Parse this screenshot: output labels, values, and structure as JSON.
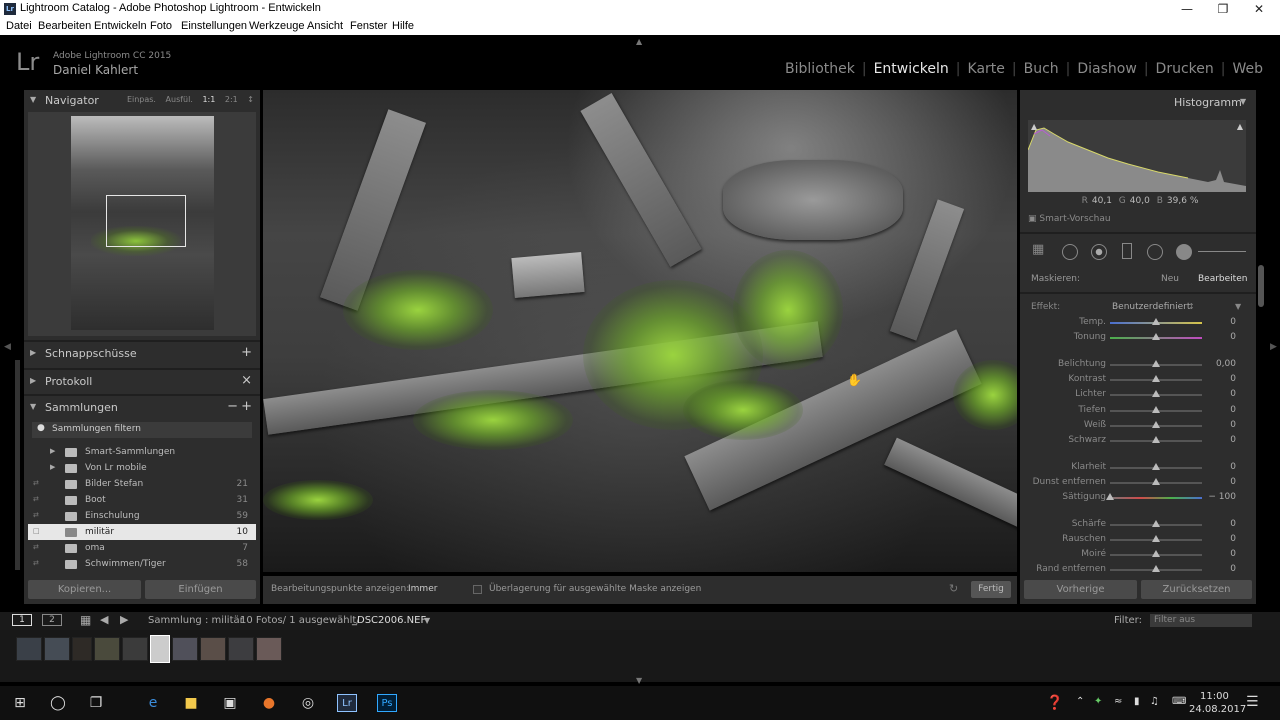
{
  "window": {
    "title": "Lightroom Catalog - Adobe Photoshop Lightroom - Entwickeln",
    "app_icon": "Lr"
  },
  "menu": [
    "Datei",
    "Bearbeiten",
    "Entwickeln",
    "Foto",
    "Einstellungen",
    "Werkzeuge",
    "Ansicht",
    "Fenster",
    "Hilfe"
  ],
  "identity": {
    "logo": "Lr",
    "product": "Adobe Lightroom CC 2015",
    "user": "Daniel Kahlert"
  },
  "modules": [
    "Bibliothek",
    "Entwickeln",
    "Karte",
    "Buch",
    "Diashow",
    "Drucken",
    "Web"
  ],
  "active_module": "Entwickeln",
  "left": {
    "navigator": {
      "title": "Navigator",
      "options": [
        "Einpas.",
        "Ausfül.",
        "1:1",
        "2:1"
      ]
    },
    "snapshots": {
      "title": "Schnappschüsse",
      "action": "+"
    },
    "history": {
      "title": "Protokoll",
      "action": "×"
    },
    "collections": {
      "title": "Sammlungen",
      "actions": [
        "−",
        "+"
      ],
      "filter": "Sammlungen filtern",
      "items": [
        {
          "label": "Smart-Sammlungen",
          "count": ""
        },
        {
          "label": "Von Lr mobile",
          "count": ""
        },
        {
          "label": "Bilder Stefan",
          "count": "21"
        },
        {
          "label": "Boot",
          "count": "31"
        },
        {
          "label": "Einschulung",
          "count": "59"
        },
        {
          "label": "militär",
          "count": "10"
        },
        {
          "label": "oma",
          "count": "7"
        },
        {
          "label": "Schwimmen/Tiger",
          "count": "58"
        }
      ]
    },
    "copy_button": "Kopieren...",
    "paste_button": "Einfügen"
  },
  "toolbar": {
    "edit_points_label": "Bearbeitungspunkte anzeigen:",
    "edit_points_value": "Immer",
    "overlay_label": "Überlagerung für ausgewählte Maske anzeigen",
    "done_button": "Fertig"
  },
  "right": {
    "histogram": {
      "title": "Histogramm",
      "r_label": "R",
      "r": "40,1",
      "g_label": "G",
      "g": "40,0",
      "b_label": "B",
      "b": "39,6",
      "unit": "%",
      "smart_preview": "Smart-Vorschau"
    },
    "mask": {
      "label": "Maskieren:",
      "new": "Neu",
      "edit": "Bearbeiten"
    },
    "effect": {
      "label": "Effekt:",
      "value": "Benutzerdefiniert"
    },
    "sliders": [
      {
        "label": "Temp.",
        "value": "0",
        "pos": 0.5
      },
      {
        "label": "Tonung",
        "value": "0",
        "pos": 0.5
      },
      {
        "label": "Belichtung",
        "value": "0,00",
        "pos": 0.5
      },
      {
        "label": "Kontrast",
        "value": "0",
        "pos": 0.5
      },
      {
        "label": "Lichter",
        "value": "0",
        "pos": 0.5
      },
      {
        "label": "Tiefen",
        "value": "0",
        "pos": 0.5
      },
      {
        "label": "Weiß",
        "value": "0",
        "pos": 0.5
      },
      {
        "label": "Schwarz",
        "value": "0",
        "pos": 0.5
      },
      {
        "label": "Klarheit",
        "value": "0",
        "pos": 0.5
      },
      {
        "label": "Dunst entfernen",
        "value": "0",
        "pos": 0.5
      },
      {
        "label": "Sättigung",
        "value": "− 100",
        "pos": 0.0
      },
      {
        "label": "Schärfe",
        "value": "0",
        "pos": 0.5
      },
      {
        "label": "Rauschen",
        "value": "0",
        "pos": 0.5
      },
      {
        "label": "Moiré",
        "value": "0",
        "pos": 0.5
      },
      {
        "label": "Rand entfernen",
        "value": "0",
        "pos": 0.5
      }
    ],
    "prev_button": "Vorherige",
    "reset_button": "Zurücksetzen"
  },
  "filmstrip": {
    "screen1": "1",
    "screen2": "2",
    "source": "Sammlung : militär",
    "info": "10 Fotos/ 1 ausgewählt/",
    "file": "_DSC2006.NEF",
    "filter_label": "Filter:",
    "filter_value": "Filter aus",
    "thumb_count": 10,
    "selected_index": 5
  },
  "taskbar": {
    "time": "11:00",
    "date": "24.08.2017"
  }
}
